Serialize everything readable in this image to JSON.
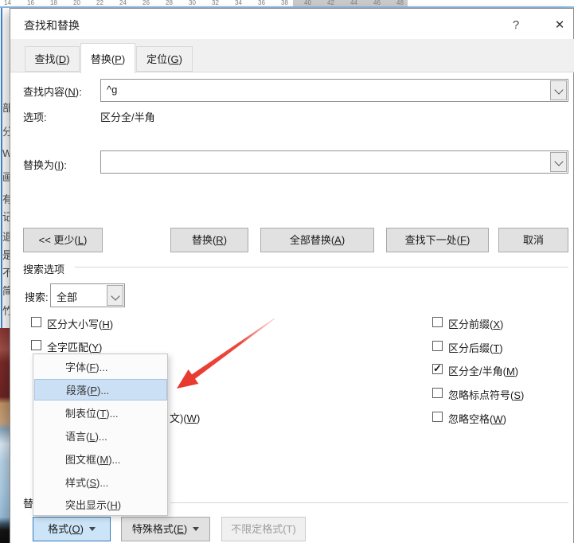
{
  "ruler": {
    "numbers": [
      "14",
      "16",
      "18",
      "20",
      "22",
      "24",
      "26",
      "28",
      "30",
      "32",
      "34",
      "36",
      "38",
      "40",
      "42",
      "44",
      "46",
      "48"
    ]
  },
  "background": {
    "partial_glyphs": [
      "部",
      "分",
      "W",
      "画",
      "有",
      "记",
      "退",
      "是",
      "不",
      "简",
      "竹"
    ]
  },
  "titlebar": {
    "title": "查找和替换",
    "help": "?",
    "close": "✕"
  },
  "tabs": [
    {
      "label": {
        "pre": "查找(",
        "key": "D",
        "post": ")"
      }
    },
    {
      "label": {
        "pre": "替换(",
        "key": "P",
        "post": ")"
      }
    },
    {
      "label": {
        "pre": "定位(",
        "key": "G",
        "post": ")"
      }
    }
  ],
  "find": {
    "label": {
      "pre": "查找内容(",
      "key": "N",
      "post": "):"
    },
    "value": "^g"
  },
  "options_row": {
    "label": "选项:",
    "value": "区分全/半角"
  },
  "replace": {
    "label": {
      "pre": "替换为(",
      "key": "I",
      "post": "):"
    },
    "value": ""
  },
  "buttons": {
    "less": {
      "pre": "<< 更少(",
      "key": "L",
      "post": ")"
    },
    "replace": {
      "pre": "替换(",
      "key": "R",
      "post": ")"
    },
    "replace_all": {
      "pre": "全部替换(",
      "key": "A",
      "post": ")"
    },
    "find_next": {
      "pre": "查找下一处(",
      "key": "F",
      "post": ")"
    },
    "cancel": "取消"
  },
  "search_options": {
    "group_label": "搜索选项",
    "search_label": "搜索:",
    "search_value": "全部",
    "left_checkboxes": [
      {
        "label": {
          "pre": "区分大小写(",
          "key": "H",
          "post": ")"
        },
        "checked": false
      },
      {
        "label": {
          "pre": "全字匹配(",
          "key": "Y",
          "post": ")"
        },
        "checked": false
      }
    ],
    "right_checkboxes": [
      {
        "label": {
          "pre": "区分前缀(",
          "key": "X",
          "post": ")"
        },
        "checked": false
      },
      {
        "label": {
          "pre": "区分后缀(",
          "key": "T",
          "post": ")"
        },
        "checked": false
      },
      {
        "label": {
          "pre": "区分全/半角(",
          "key": "M",
          "post": ")"
        },
        "checked": true
      },
      {
        "label": {
          "pre": "忽略标点符号(",
          "key": "S",
          "post": ")"
        },
        "checked": false
      },
      {
        "label": {
          "pre": "忽略空格(",
          "key": "W",
          "post": ")"
        },
        "checked": false
      }
    ],
    "partial_checkbox_text": {
      "pre": "文)(",
      "key": "W",
      "post": ")"
    }
  },
  "replace_group": {
    "partial_label": "替"
  },
  "format_menu": {
    "items": [
      {
        "label": {
          "pre": "字体(",
          "key": "F",
          "post": ")..."
        }
      },
      {
        "label": {
          "pre": "段落(",
          "key": "P",
          "post": ")..."
        }
      },
      {
        "label": {
          "pre": "制表位(",
          "key": "T",
          "post": ")..."
        }
      },
      {
        "label": {
          "pre": "语言(",
          "key": "L",
          "post": ")..."
        }
      },
      {
        "label": {
          "pre": "图文框(",
          "key": "M",
          "post": ")..."
        }
      },
      {
        "label": {
          "pre": "样式(",
          "key": "S",
          "post": ")..."
        }
      },
      {
        "label": {
          "pre": "突出显示(",
          "key": "H",
          "post": ")"
        }
      }
    ]
  },
  "bottom_buttons": {
    "format": {
      "pre": "格式(",
      "key": "O",
      "post": ")"
    },
    "special": {
      "pre": "特殊格式(",
      "key": "E",
      "post": ")"
    },
    "no_format": "不限定格式(T)"
  },
  "colors": {
    "menu_highlight_bg": "#cce0f5",
    "menu_highlight_border": "#a6c5e5",
    "format_button_bg": "#cce4f7",
    "format_button_border": "#3579b8",
    "arrow_red": "#e8372b",
    "doc_edge_blue": "#3f88d4"
  }
}
